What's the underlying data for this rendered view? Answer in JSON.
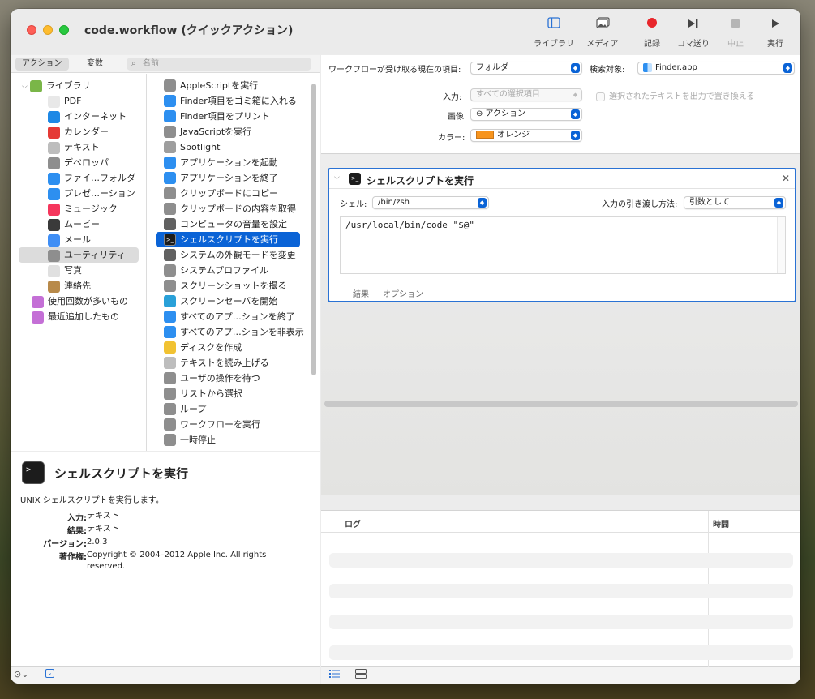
{
  "window": {
    "title": "code.workflow (クイックアクション)"
  },
  "toolbar": {
    "library": "ライブラリ",
    "media": "メディア",
    "record": "記録",
    "step": "コマ送り",
    "stop": "中止",
    "run": "実行"
  },
  "left": {
    "tab_actions": "アクション",
    "tab_variables": "変数",
    "search_placeholder": "名前",
    "library_items": [
      {
        "label": "ライブラリ",
        "icon": "library-icon",
        "color": "#7ab648"
      },
      {
        "label": "PDF",
        "icon": "pdf-icon",
        "color": "#e8e8e8"
      },
      {
        "label": "インターネット",
        "icon": "globe-icon",
        "color": "#1e88e5"
      },
      {
        "label": "カレンダー",
        "icon": "calendar-icon",
        "color": "#e53935"
      },
      {
        "label": "テキスト",
        "icon": "text-icon",
        "color": "#bdbdbd"
      },
      {
        "label": "デベロッパ",
        "icon": "developer-icon",
        "color": "#8e8e8e"
      },
      {
        "label": "ファイ…フォルダ",
        "icon": "finder-icon",
        "color": "#2d8ff0"
      },
      {
        "label": "プレゼ…ーション",
        "icon": "keynote-icon",
        "color": "#2d8ff0"
      },
      {
        "label": "ミュージック",
        "icon": "music-icon",
        "color": "#f5365c"
      },
      {
        "label": "ムービー",
        "icon": "movie-icon",
        "color": "#3a3a3a"
      },
      {
        "label": "メール",
        "icon": "mail-icon",
        "color": "#3f8ef5"
      },
      {
        "label": "ユーティリティ",
        "icon": "utilities-icon",
        "color": "#8e8e8e"
      },
      {
        "label": "写真",
        "icon": "photos-icon",
        "color": "#e0e0e0"
      },
      {
        "label": "連絡先",
        "icon": "contacts-icon",
        "color": "#b88a4a"
      },
      {
        "label": "使用回数が多いもの",
        "icon": "smart-folder-icon",
        "color": "#c46fd6"
      },
      {
        "label": "最近追加したもの",
        "icon": "smart-folder-icon",
        "color": "#c46fd6"
      }
    ],
    "actions": [
      {
        "label": "AppleScriptを実行",
        "icon": "script-icon",
        "color": "#8e8e8e"
      },
      {
        "label": "Finder項目をゴミ箱に入れる",
        "icon": "finder-icon",
        "color": "#2d8ff0"
      },
      {
        "label": "Finder項目をプリント",
        "icon": "finder-icon",
        "color": "#2d8ff0"
      },
      {
        "label": "JavaScriptを実行",
        "icon": "script-icon",
        "color": "#8e8e8e"
      },
      {
        "label": "Spotlight",
        "icon": "spotlight-icon",
        "color": "#9e9e9e"
      },
      {
        "label": "アプリケーションを起動",
        "icon": "finder-icon",
        "color": "#2d8ff0"
      },
      {
        "label": "アプリケーションを終了",
        "icon": "finder-icon",
        "color": "#2d8ff0"
      },
      {
        "label": "クリップボードにコピー",
        "icon": "utilities-icon",
        "color": "#8e8e8e"
      },
      {
        "label": "クリップボードの内容を取得",
        "icon": "utilities-icon",
        "color": "#8e8e8e"
      },
      {
        "label": "コンピュータの音量を設定",
        "icon": "volume-icon",
        "color": "#616161"
      },
      {
        "label": "シェルスクリプトを実行",
        "icon": "terminal-icon",
        "color": "#1c1c1c"
      },
      {
        "label": "システムの外観モードを変更",
        "icon": "appearance-icon",
        "color": "#616161"
      },
      {
        "label": "システムプロファイル",
        "icon": "utilities-icon",
        "color": "#8e8e8e"
      },
      {
        "label": "スクリーンショットを撮る",
        "icon": "utilities-icon",
        "color": "#8e8e8e"
      },
      {
        "label": "スクリーンセーバを開始",
        "icon": "screensaver-icon",
        "color": "#29a0d8"
      },
      {
        "label": "すべてのアプ…ションを終了",
        "icon": "finder-icon",
        "color": "#2d8ff0"
      },
      {
        "label": "すべてのアプ…ションを非表示",
        "icon": "finder-icon",
        "color": "#2d8ff0"
      },
      {
        "label": "ディスクを作成",
        "icon": "disk-icon",
        "color": "#f1c232"
      },
      {
        "label": "テキストを読み上げる",
        "icon": "text-icon",
        "color": "#bdbdbd"
      },
      {
        "label": "ユーザの操作を待つ",
        "icon": "automator-icon",
        "color": "#8e8e8e"
      },
      {
        "label": "リストから選択",
        "icon": "automator-icon",
        "color": "#8e8e8e"
      },
      {
        "label": "ループ",
        "icon": "automator-icon",
        "color": "#8e8e8e"
      },
      {
        "label": "ワークフローを実行",
        "icon": "automator-icon",
        "color": "#8e8e8e"
      },
      {
        "label": "一時停止",
        "icon": "automator-icon",
        "color": "#8e8e8e"
      }
    ],
    "selected_action_index": 10
  },
  "description": {
    "title": "シェルスクリプトを実行",
    "text": "UNIX シェルスクリプトを実行します。",
    "input_label": "入力:",
    "input_value": "テキスト",
    "result_label": "結果:",
    "result_value": "テキスト",
    "version_label": "バージョン:",
    "version_value": "2.0.3",
    "copyright_label": "著作権:",
    "copyright_value": "Copyright © 2004–2012 Apple Inc.  All rights reserved."
  },
  "workflow": {
    "receives_label": "ワークフローが受け取る現在の項目:",
    "receives_value": "フォルダ",
    "search_target_label": "検索対象:",
    "search_target_value": "Finder.app",
    "input_label": "入力:",
    "input_value": "すべての選択項目",
    "replace_text_label": "選択されたテキストを出力で置き換える",
    "image_label": "画像",
    "image_value": "⊖ アクション",
    "color_label": "カラー:",
    "color_value": "オレンジ",
    "color_hex": "#f7941d"
  },
  "action_card": {
    "title": "シェルスクリプトを実行",
    "shell_label": "シェル:",
    "shell_value": "/bin/zsh",
    "pass_input_label": "入力の引き渡し方法:",
    "pass_input_value": "引数として",
    "script": "/usr/local/bin/code \"$@\"",
    "tab_results": "結果",
    "tab_options": "オプション"
  },
  "log": {
    "col_log": "ログ",
    "col_time": "時間"
  }
}
